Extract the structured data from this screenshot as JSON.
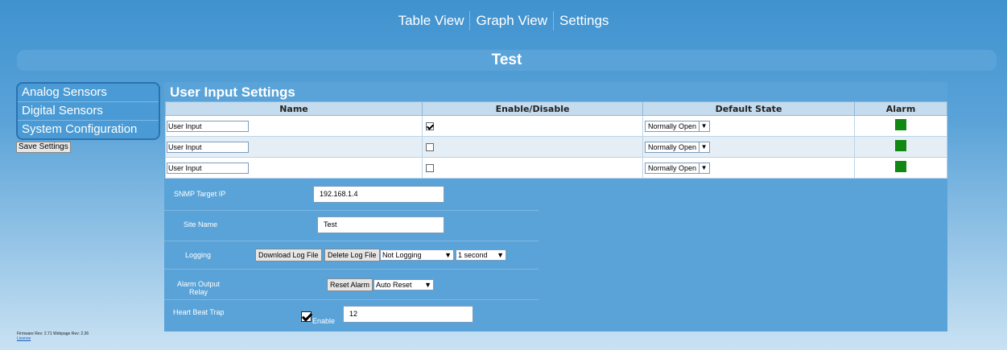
{
  "nav": {
    "items": [
      "Table View",
      "Graph View",
      "Settings"
    ]
  },
  "title": "Test",
  "sidebar": {
    "items": [
      "Analog Sensors",
      "Digital Sensors",
      "System Configuration"
    ],
    "save_label": "Save Settings"
  },
  "panel": {
    "title": "User Input Settings",
    "columns": [
      "Name",
      "Enable/Disable",
      "Default State",
      "Alarm"
    ],
    "rows": [
      {
        "name": "User Input",
        "enabled": true,
        "default_state": "Normally Open",
        "alarm_color": "#118811"
      },
      {
        "name": "User Input",
        "enabled": false,
        "default_state": "Normally Open",
        "alarm_color": "#118811"
      },
      {
        "name": "User Input",
        "enabled": false,
        "default_state": "Normally Open",
        "alarm_color": "#118811"
      }
    ]
  },
  "settings": {
    "snmp_label": "SNMP Target IP",
    "snmp_value": "192.168.1.4",
    "site_label": "Site Name",
    "site_value": "Test",
    "logging_label": "Logging",
    "download_label": "Download Log File",
    "delete_label": "Delete Log File",
    "logging_mode": "Not Logging",
    "logging_interval": "1 second",
    "alarm_relay_label_1": "Alarm Output",
    "alarm_relay_label_2": "Relay",
    "reset_alarm_label": "Reset Alarm",
    "reset_mode": "Auto Reset",
    "heartbeat_label": "Heart Beat Trap",
    "heartbeat_enable_label": "Enable",
    "heartbeat_value": "12"
  },
  "footer": {
    "firmware": "Firmware Rev: 2.71 Webpage Rev: 2.36",
    "license": "License"
  }
}
